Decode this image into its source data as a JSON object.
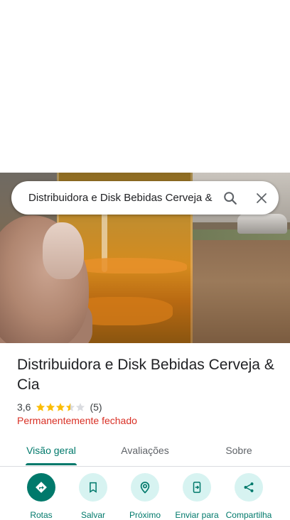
{
  "search": {
    "query": "Distribuidora e Disk Bebidas Cerveja & Cia",
    "search_icon": "search-icon",
    "close_icon": "close-icon"
  },
  "place": {
    "name": "Distribuidora e Disk Bebidas Cerveja & Cia",
    "rating": "3,6",
    "rating_value": 3.6,
    "review_count": "(5)",
    "status": "Permanentemente fechado"
  },
  "tabs": [
    {
      "label": "Visão geral",
      "active": true
    },
    {
      "label": "Avaliações",
      "active": false
    },
    {
      "label": "Sobre",
      "active": false
    }
  ],
  "actions": [
    {
      "label": "Rotas",
      "icon": "directions-icon"
    },
    {
      "label": "Salvar",
      "icon": "bookmark-icon"
    },
    {
      "label": "Próximo",
      "icon": "nearby-icon"
    },
    {
      "label": "Enviar para",
      "icon": "send-to-phone-icon"
    },
    {
      "label": "Compartilha",
      "icon": "share-icon"
    }
  ],
  "colors": {
    "accent": "#00796b",
    "action_bg": "#d7f3f1",
    "closed": "#d93025",
    "star": "#fbbc04"
  }
}
